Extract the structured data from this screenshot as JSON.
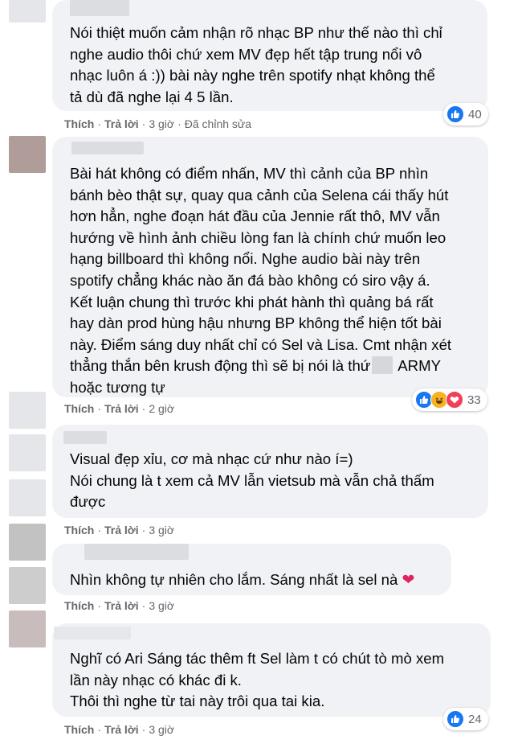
{
  "comments": [
    {
      "lines": [
        "Nói thiệt muốn cảm nhận rõ nhạc BP như thế nào thì chỉ",
        "nghe audio thôi chứ xem MV đẹp hết tập trung nổi vô",
        "nhạc luôn á :)) bài này nghe trên spotify nhạt không thể",
        "tả dù đã nghe lại 4 5 lần."
      ],
      "reactions": [
        "like"
      ],
      "reaction_count": "40",
      "like_label": "Thích",
      "reply_label": "Trả lời",
      "time": "3 giờ",
      "edited": "Đã chỉnh sửa"
    },
    {
      "lines": [
        "Bài hát không có điểm nhấn, MV thì cảnh của BP nhìn",
        "bánh bèo thật sự, quay qua cảnh của Selena cái thấy hút",
        "hơn hẳn, nghe đoạn hát đầu của Jennie rất thô, MV vẫn",
        "hướng về hình ảnh chiều lòng fan là chính chứ muốn leo",
        "hạng billboard thì không nổi. Nghe audio bài này trên",
        "spotify chẳng khác nào ăn đá bào không có siro vậy á.",
        "Kết luận chung thì trước khi phát hành thì quảng bá rất",
        "hay dàn prod hùng hậu nhưng BP không thể hiện tốt bài",
        "này. Điểm sáng duy nhất chỉ có Sel và Lisa. Cmt nhận xét",
        "thẳng thắn bên krush động thì sẽ bị nói là thứ",
        "hoặc tương tự"
      ],
      "army_suffix": "ARMY",
      "reactions": [
        "like",
        "haha",
        "love"
      ],
      "reaction_count": "33",
      "like_label": "Thích",
      "reply_label": "Trả lời",
      "time": "2 giờ"
    },
    {
      "lines": [
        "Visual đẹp xỉu, cơ mà nhạc cứ như nào í=)",
        "Nói chung là t xem cả MV lẫn vietsub mà vẫn chả thấm",
        "được"
      ],
      "like_label": "Thích",
      "reply_label": "Trả lời",
      "time": "3 giờ"
    },
    {
      "lines": [
        "Nhìn không tự nhiên cho lắm. Sáng nhất là sel nà"
      ],
      "emoji": "❤",
      "like_label": "Thích",
      "reply_label": "Trả lời",
      "time": "3 giờ"
    },
    {
      "lines": [
        "Nghĩ có Ari Sáng tác thêm ft Sel làm t có chút tò mò xem",
        "lần này nhạc có khác đi k.",
        "Thôi thì nghe từ tai này trôi qua tai kia."
      ],
      "reactions": [
        "like"
      ],
      "reaction_count": "24",
      "like_label": "Thích",
      "reply_label": "Trả lời",
      "time": "3 giờ"
    }
  ],
  "separator": "·"
}
